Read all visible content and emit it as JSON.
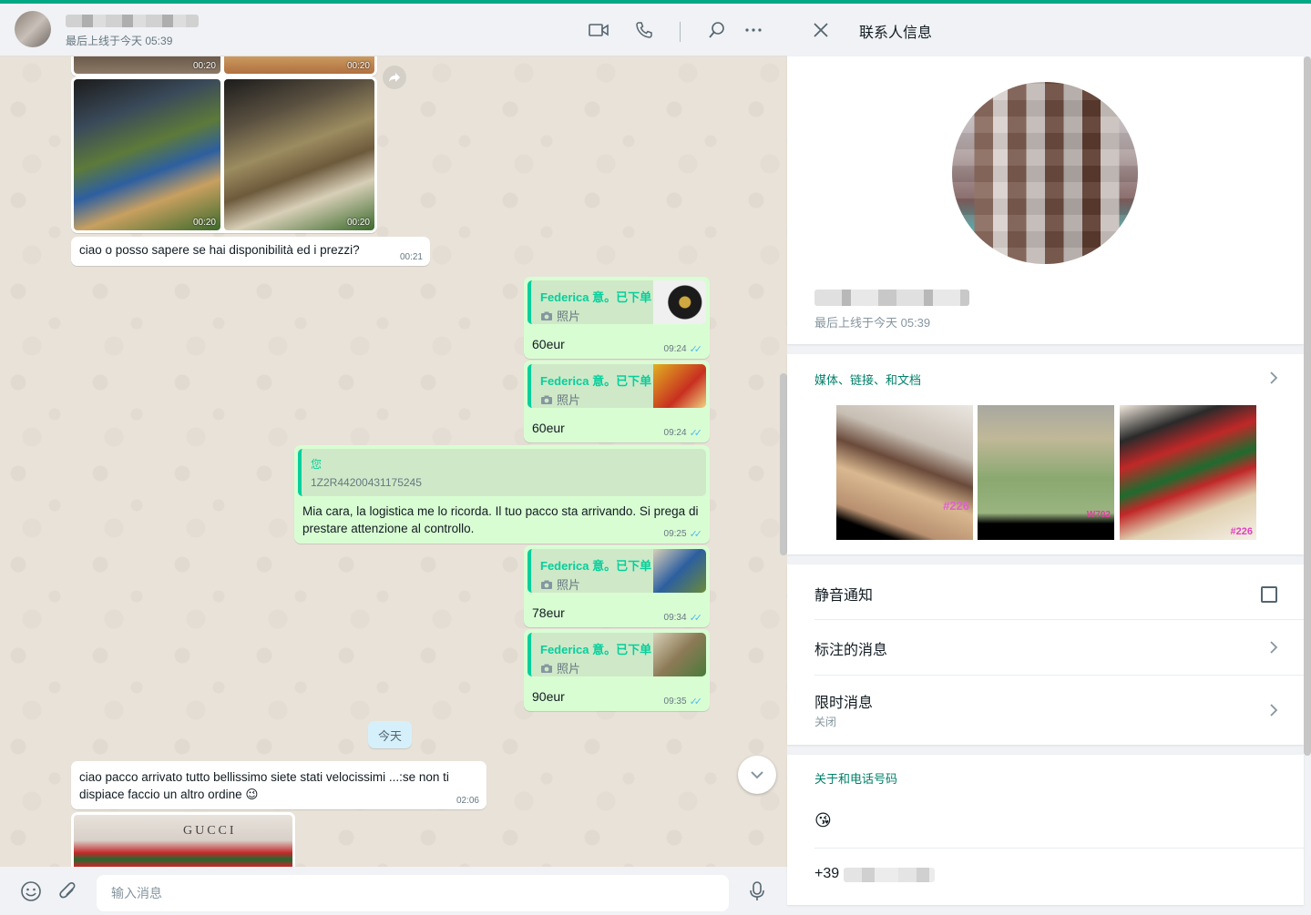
{
  "chat": {
    "header": {
      "last_seen": "最后上线于今天 05:39"
    },
    "messages": {
      "grid_top_times": [
        "00:20",
        "00:20"
      ],
      "grid_times": [
        "00:20",
        "00:20"
      ],
      "msg1": {
        "text": "ciao o posso sapere se hai disponibilità ed i prezzi?",
        "time": "00:21"
      },
      "replies": [
        {
          "sender": "Federica 意。已下单",
          "type": "照片",
          "price": "60eur",
          "time": "09:24"
        },
        {
          "sender": "Federica 意。已下单",
          "type": "照片",
          "price": "60eur",
          "time": "09:24"
        },
        {
          "sender": "Federica 意。已下单",
          "type": "照片",
          "price": "78eur",
          "time": "09:34"
        },
        {
          "sender": "Federica 意。已下单",
          "type": "照片",
          "price": "90eur",
          "time": "09:35"
        }
      ],
      "tracking": {
        "quote_sender": "您",
        "quote_text": "1Z2R44200431175245",
        "text": "Mia cara, la logistica me lo ricorda. Il tuo pacco sta arrivando. Si prega di prestare attenzione al controllo.",
        "time": "09:25"
      },
      "date_chip": "今天",
      "msg_last": {
        "text": "ciao pacco arrivato tutto bellissimo siete stati velocissimi ...:se non ti dispiace faccio un altro ordine 😉",
        "time": "02:06"
      },
      "last_image_text": "GUCCI"
    },
    "compose": {
      "placeholder": "输入消息"
    }
  },
  "info": {
    "title": "联系人信息",
    "last_seen": "最后上线于今天 05:39",
    "media": {
      "label": "媒体、链接、和文档",
      "tags": [
        "#226",
        "W702",
        "#226"
      ]
    },
    "rows": {
      "mute": "静音通知",
      "starred": "标注的消息",
      "disappearing": "限时消息",
      "disappearing_sub": "关闭"
    },
    "about": {
      "label": "关于和电话号码",
      "emoji": "😘",
      "phone_prefix": "+39"
    }
  }
}
